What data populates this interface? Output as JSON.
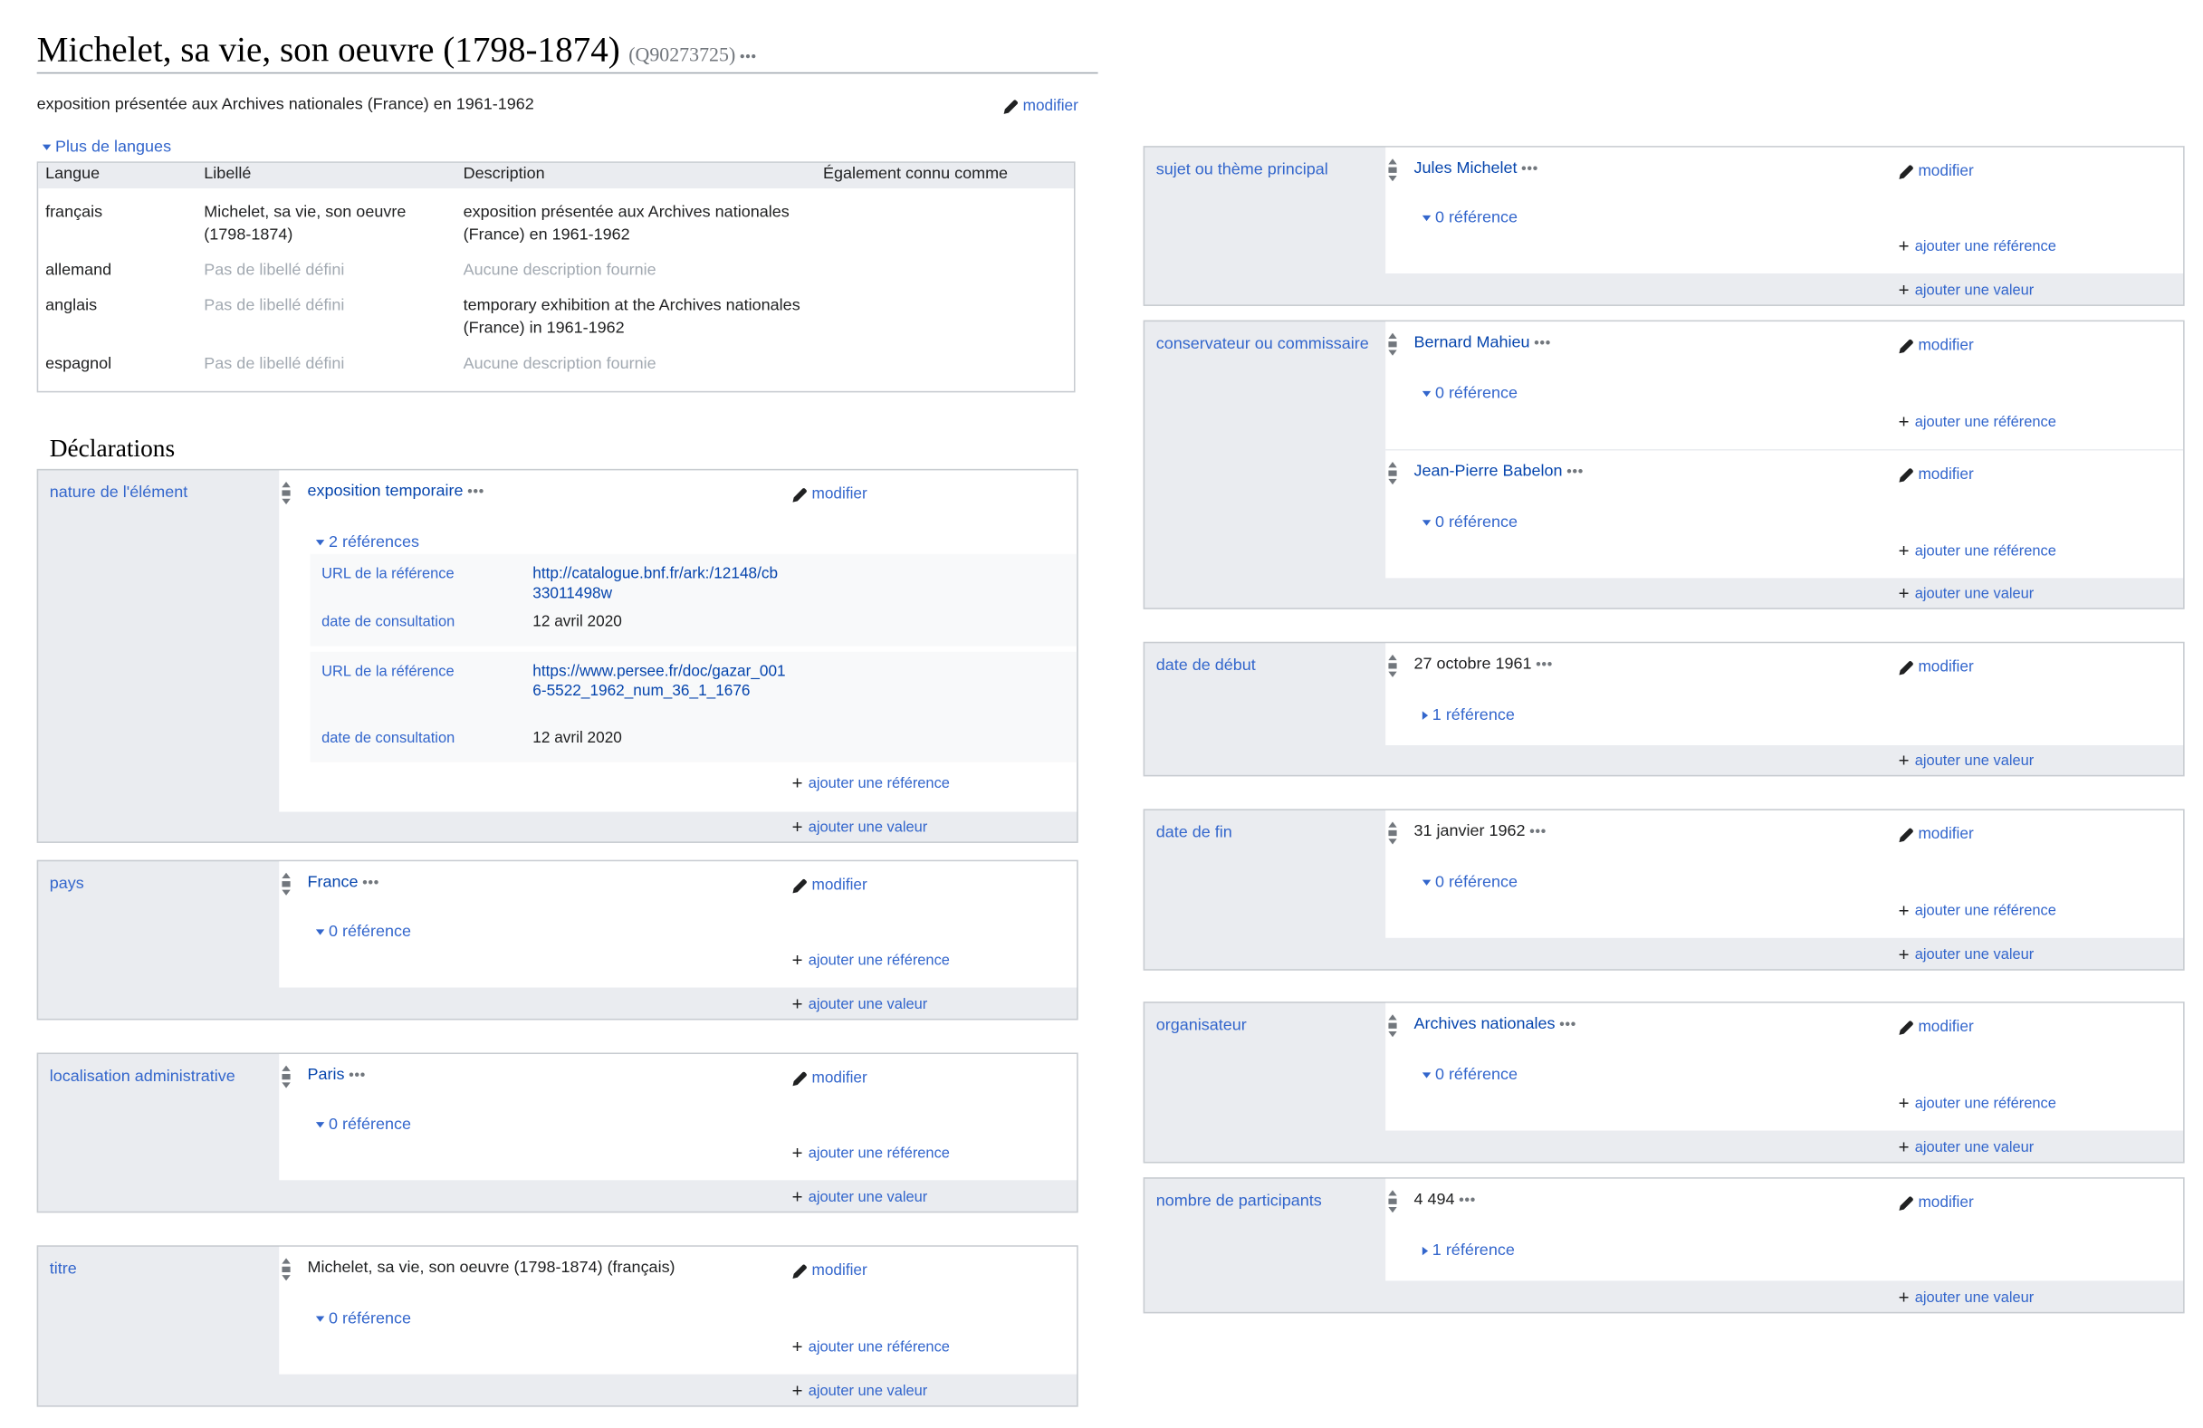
{
  "item": {
    "title": "Michelet, sa vie, son oeuvre (1798-1874)",
    "qid": "(Q90273725)",
    "description": "exposition présentée aux Archives nationales (France) en 1961-1962",
    "edit_label": "modifier"
  },
  "languages": {
    "toggle_label": "Plus de langues",
    "headers": [
      "Langue",
      "Libellé",
      "Description",
      "Également connu comme"
    ],
    "rows": [
      {
        "lang": "français",
        "label": "Michelet, sa vie, son oeuvre (1798-1874)",
        "description": "exposition présentée aux Archives nationales (France) en 1961-1962"
      },
      {
        "lang": "allemand",
        "label": "Pas de libellé défini",
        "description": "Aucune description fournie"
      },
      {
        "lang": "anglais",
        "label": "Pas de libellé défini",
        "description": "temporary exhibition at the Archives nationales (France) in 1961-1962"
      },
      {
        "lang": "espagnol",
        "label": "Pas de libellé défini",
        "description": "Aucune description fournie"
      }
    ]
  },
  "declarations": {
    "heading": "Déclarations",
    "edit_label": "modifier",
    "add_reference_label": "ajouter une référence",
    "add_value_label": "ajouter une valeur",
    "more_icon": "dots-menu-icon",
    "groups": [
      {
        "property": "nature de l'élément",
        "statements": [
          {
            "value": "exposition temporaire",
            "refs_label": "2 références",
            "references": [
              {
                "prop1": "URL de la référence",
                "val1": "http://catalogue.bnf.fr/ark:/12148/cb33011498w",
                "prop2": "date de consultation",
                "val2": "12 avril 2020"
              },
              {
                "prop1": "URL de la référence",
                "val1": "https://www.persee.fr/doc/gazar_0016-5522_1962_num_36_1_1676",
                "prop2": "date de consultation",
                "val2": "12 avril 2020"
              }
            ]
          }
        ]
      },
      {
        "property": "pays",
        "statements": [
          {
            "value": "France",
            "refs_label": "0 référence"
          }
        ]
      },
      {
        "property": "localisation administrative",
        "statements": [
          {
            "value": "Paris",
            "refs_label": "0 référence"
          }
        ]
      },
      {
        "property": "titre",
        "statements": [
          {
            "value": "Michelet, sa vie, son oeuvre (1798-1874) (français)",
            "refs_label": "0 référence"
          }
        ]
      },
      {
        "property": "sujet ou thème principal",
        "statements": [
          {
            "value": "Jules Michelet",
            "refs_label": "0 référence"
          }
        ]
      },
      {
        "property": "conservateur ou commissaire",
        "statements": [
          {
            "value": "Bernard Mahieu",
            "refs_label": "0 référence"
          },
          {
            "value": "Jean-Pierre Babelon",
            "refs_label": "0 référence"
          }
        ]
      },
      {
        "property": "date de début",
        "statements": [
          {
            "value": "27 octobre 1961",
            "refs_label": "1 référence"
          }
        ]
      },
      {
        "property": "date de fin",
        "statements": [
          {
            "value": "31 janvier 1962",
            "refs_label": "0 référence"
          }
        ]
      },
      {
        "property": "organisateur",
        "statements": [
          {
            "value": "Archives nationales",
            "refs_label": "0 référence"
          }
        ]
      },
      {
        "property": "nombre de participants",
        "statements": [
          {
            "value": "4 494",
            "refs_label": "1 référence"
          }
        ]
      }
    ]
  }
}
